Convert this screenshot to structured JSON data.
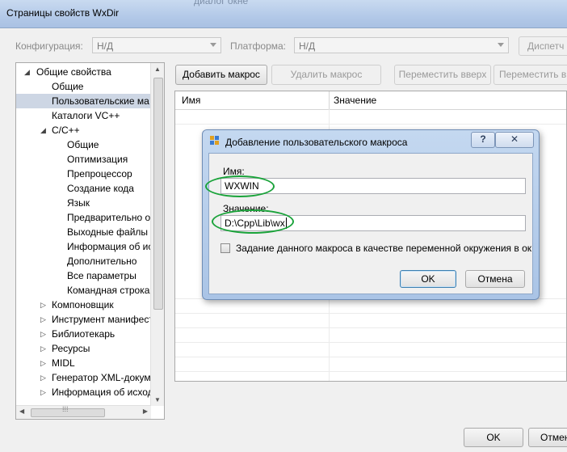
{
  "window": {
    "title": "Страницы свойств WxDir",
    "background_text": "диалог окне"
  },
  "toolbar": {
    "config_label": "Конфигурация:",
    "config_value": "Н/Д",
    "platform_label": "Платформа:",
    "platform_value": "Н/Д",
    "manager_button": "Диспетч"
  },
  "actions": {
    "add": "Добавить макрос",
    "delete": "Удалить макрос",
    "move_up": "Переместить вверх",
    "move_down": "Переместить вн"
  },
  "tree": {
    "items": [
      {
        "label": "Общие свойства",
        "expander": "◢"
      },
      {
        "label": "Общие"
      },
      {
        "label": "Пользовательские ма"
      },
      {
        "label": "Каталоги VC++"
      },
      {
        "label": "C/C++",
        "expander": "◢"
      },
      {
        "label": "Общие"
      },
      {
        "label": "Оптимизация"
      },
      {
        "label": "Препроцессор"
      },
      {
        "label": "Создание кода"
      },
      {
        "label": "Язык"
      },
      {
        "label": "Предварительно от"
      },
      {
        "label": "Выходные файлы"
      },
      {
        "label": "Информация об ис"
      },
      {
        "label": "Дополнительно"
      },
      {
        "label": "Все параметры"
      },
      {
        "label": "Командная строка"
      },
      {
        "label": "Компоновщик",
        "expander": "▷"
      },
      {
        "label": "Инструмент манифест",
        "expander": "▷"
      },
      {
        "label": "Библиотекарь",
        "expander": "▷"
      },
      {
        "label": "Ресурсы",
        "expander": "▷"
      },
      {
        "label": "MIDL",
        "expander": "▷"
      },
      {
        "label": "Генератор XML-докум",
        "expander": "▷"
      },
      {
        "label": "Информация об исход",
        "expander": "▷"
      }
    ]
  },
  "grid": {
    "col_name": "Имя",
    "col_value": "Значение"
  },
  "dialog": {
    "title": "Добавление пользовательского макроса",
    "help": "?",
    "name_label": "Имя:",
    "name_value": "WXWIN",
    "value_label": "Значение:",
    "value_value": "D:\\Cpp\\Lib\\wx",
    "checkbox_label": "Задание данного макроса в качестве переменной окружения в окружен",
    "checkbox_checked": false,
    "ok": "OK",
    "cancel": "Отмена"
  },
  "footer": {
    "ok": "OK",
    "cancel": "Отмен"
  },
  "colors": {
    "highlight": "#1aa33a",
    "selection": "#cdd6e4",
    "titlebar": "#b3c9e8"
  }
}
